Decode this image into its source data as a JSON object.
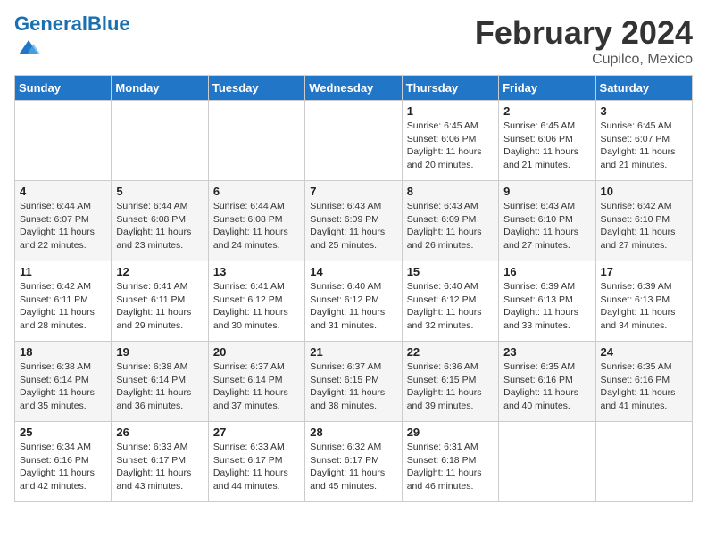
{
  "header": {
    "logo_general": "General",
    "logo_blue": "Blue",
    "title": "February 2024",
    "subtitle": "Cupilco, Mexico"
  },
  "weekdays": [
    "Sunday",
    "Monday",
    "Tuesday",
    "Wednesday",
    "Thursday",
    "Friday",
    "Saturday"
  ],
  "weeks": [
    [
      {
        "day": "",
        "info": ""
      },
      {
        "day": "",
        "info": ""
      },
      {
        "day": "",
        "info": ""
      },
      {
        "day": "",
        "info": ""
      },
      {
        "day": "1",
        "info": "Sunrise: 6:45 AM\nSunset: 6:06 PM\nDaylight: 11 hours and 20 minutes."
      },
      {
        "day": "2",
        "info": "Sunrise: 6:45 AM\nSunset: 6:06 PM\nDaylight: 11 hours and 21 minutes."
      },
      {
        "day": "3",
        "info": "Sunrise: 6:45 AM\nSunset: 6:07 PM\nDaylight: 11 hours and 21 minutes."
      }
    ],
    [
      {
        "day": "4",
        "info": "Sunrise: 6:44 AM\nSunset: 6:07 PM\nDaylight: 11 hours and 22 minutes."
      },
      {
        "day": "5",
        "info": "Sunrise: 6:44 AM\nSunset: 6:08 PM\nDaylight: 11 hours and 23 minutes."
      },
      {
        "day": "6",
        "info": "Sunrise: 6:44 AM\nSunset: 6:08 PM\nDaylight: 11 hours and 24 minutes."
      },
      {
        "day": "7",
        "info": "Sunrise: 6:43 AM\nSunset: 6:09 PM\nDaylight: 11 hours and 25 minutes."
      },
      {
        "day": "8",
        "info": "Sunrise: 6:43 AM\nSunset: 6:09 PM\nDaylight: 11 hours and 26 minutes."
      },
      {
        "day": "9",
        "info": "Sunrise: 6:43 AM\nSunset: 6:10 PM\nDaylight: 11 hours and 27 minutes."
      },
      {
        "day": "10",
        "info": "Sunrise: 6:42 AM\nSunset: 6:10 PM\nDaylight: 11 hours and 27 minutes."
      }
    ],
    [
      {
        "day": "11",
        "info": "Sunrise: 6:42 AM\nSunset: 6:11 PM\nDaylight: 11 hours and 28 minutes."
      },
      {
        "day": "12",
        "info": "Sunrise: 6:41 AM\nSunset: 6:11 PM\nDaylight: 11 hours and 29 minutes."
      },
      {
        "day": "13",
        "info": "Sunrise: 6:41 AM\nSunset: 6:12 PM\nDaylight: 11 hours and 30 minutes."
      },
      {
        "day": "14",
        "info": "Sunrise: 6:40 AM\nSunset: 6:12 PM\nDaylight: 11 hours and 31 minutes."
      },
      {
        "day": "15",
        "info": "Sunrise: 6:40 AM\nSunset: 6:12 PM\nDaylight: 11 hours and 32 minutes."
      },
      {
        "day": "16",
        "info": "Sunrise: 6:39 AM\nSunset: 6:13 PM\nDaylight: 11 hours and 33 minutes."
      },
      {
        "day": "17",
        "info": "Sunrise: 6:39 AM\nSunset: 6:13 PM\nDaylight: 11 hours and 34 minutes."
      }
    ],
    [
      {
        "day": "18",
        "info": "Sunrise: 6:38 AM\nSunset: 6:14 PM\nDaylight: 11 hours and 35 minutes."
      },
      {
        "day": "19",
        "info": "Sunrise: 6:38 AM\nSunset: 6:14 PM\nDaylight: 11 hours and 36 minutes."
      },
      {
        "day": "20",
        "info": "Sunrise: 6:37 AM\nSunset: 6:14 PM\nDaylight: 11 hours and 37 minutes."
      },
      {
        "day": "21",
        "info": "Sunrise: 6:37 AM\nSunset: 6:15 PM\nDaylight: 11 hours and 38 minutes."
      },
      {
        "day": "22",
        "info": "Sunrise: 6:36 AM\nSunset: 6:15 PM\nDaylight: 11 hours and 39 minutes."
      },
      {
        "day": "23",
        "info": "Sunrise: 6:35 AM\nSunset: 6:16 PM\nDaylight: 11 hours and 40 minutes."
      },
      {
        "day": "24",
        "info": "Sunrise: 6:35 AM\nSunset: 6:16 PM\nDaylight: 11 hours and 41 minutes."
      }
    ],
    [
      {
        "day": "25",
        "info": "Sunrise: 6:34 AM\nSunset: 6:16 PM\nDaylight: 11 hours and 42 minutes."
      },
      {
        "day": "26",
        "info": "Sunrise: 6:33 AM\nSunset: 6:17 PM\nDaylight: 11 hours and 43 minutes."
      },
      {
        "day": "27",
        "info": "Sunrise: 6:33 AM\nSunset: 6:17 PM\nDaylight: 11 hours and 44 minutes."
      },
      {
        "day": "28",
        "info": "Sunrise: 6:32 AM\nSunset: 6:17 PM\nDaylight: 11 hours and 45 minutes."
      },
      {
        "day": "29",
        "info": "Sunrise: 6:31 AM\nSunset: 6:18 PM\nDaylight: 11 hours and 46 minutes."
      },
      {
        "day": "",
        "info": ""
      },
      {
        "day": "",
        "info": ""
      }
    ]
  ]
}
